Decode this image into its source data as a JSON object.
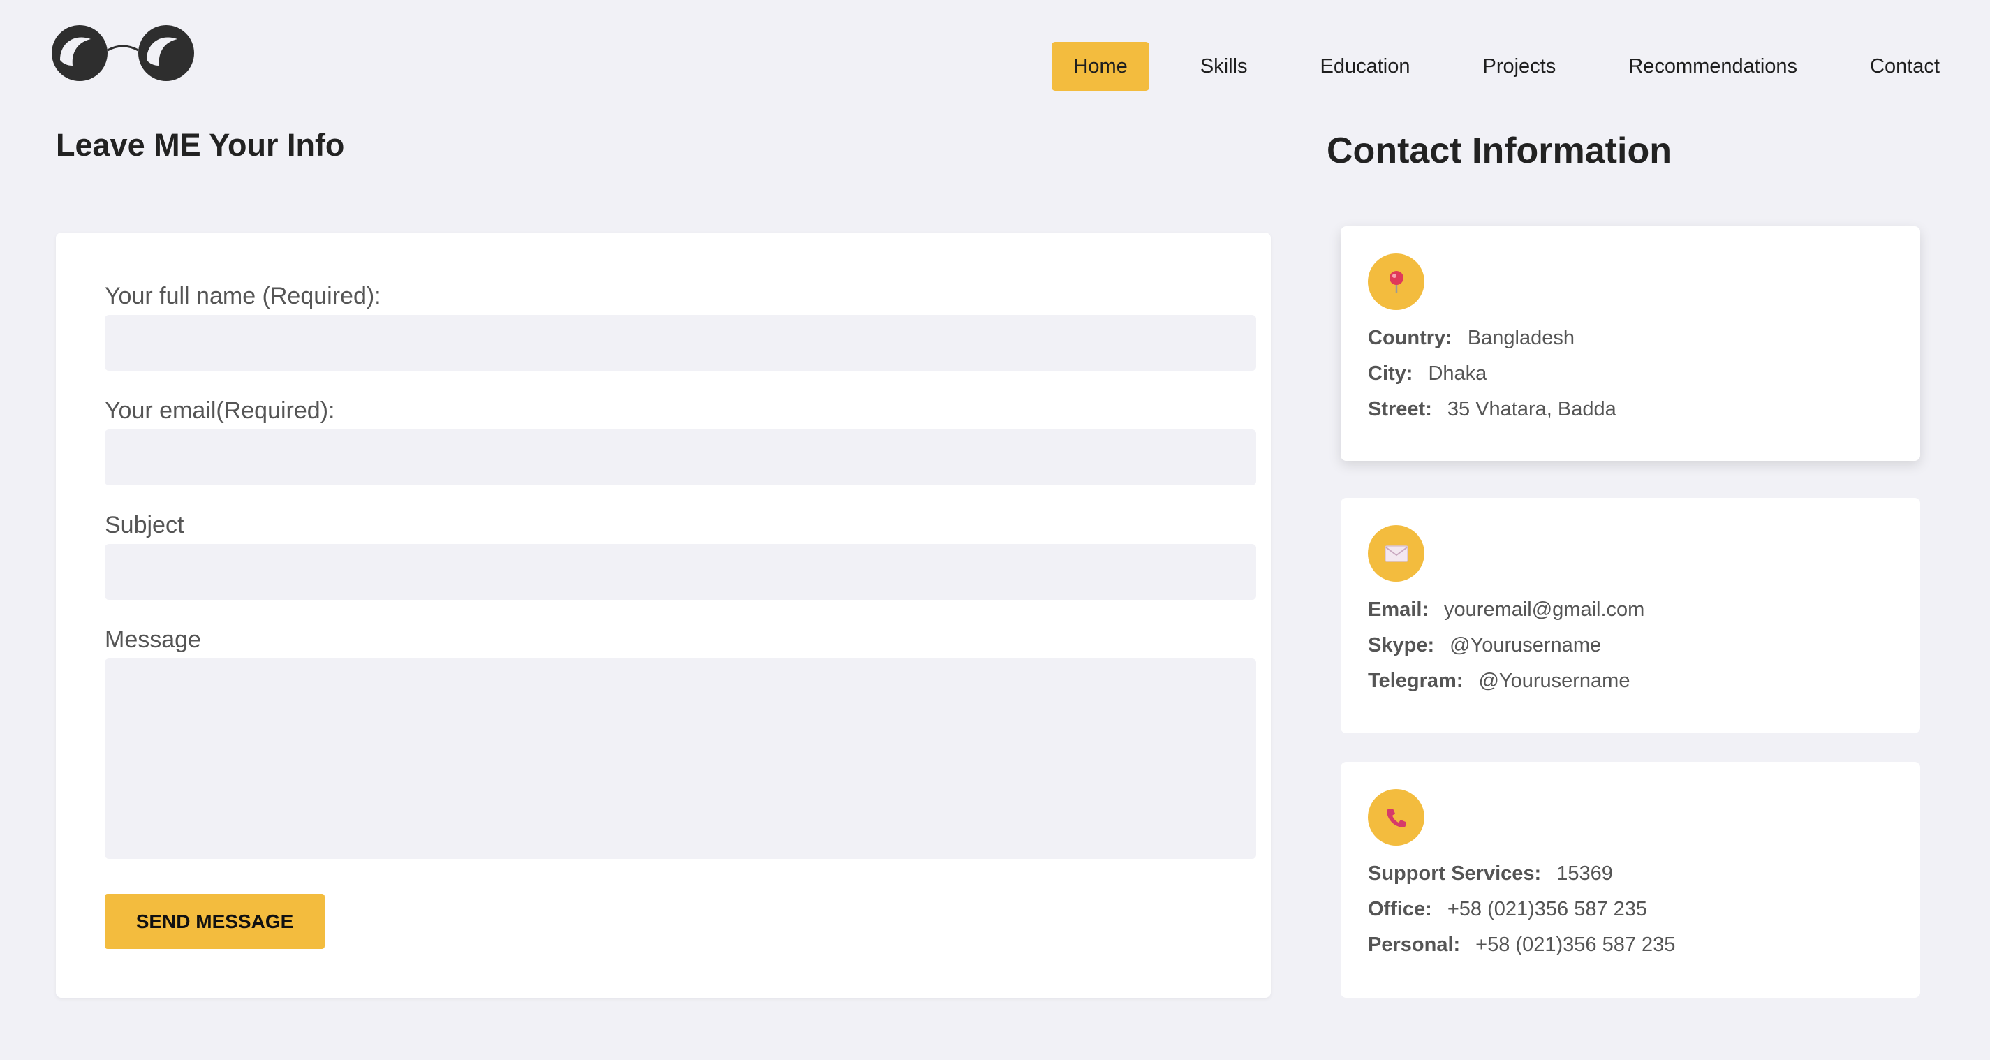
{
  "nav": {
    "items": [
      {
        "label": "Home",
        "active": true
      },
      {
        "label": "Skills",
        "active": false
      },
      {
        "label": "Education",
        "active": false
      },
      {
        "label": "Projects",
        "active": false
      },
      {
        "label": "Recommendations",
        "active": false
      },
      {
        "label": "Contact",
        "active": false
      }
    ]
  },
  "form": {
    "heading": "Leave ME Your Info",
    "name_label": "Your full name (Required):",
    "name_value": "",
    "email_label": "Your email(Required):",
    "email_value": "",
    "subject_label": "Subject",
    "subject_value": "",
    "message_label": "Message",
    "message_value": "",
    "send_label": "SEND MESSAGE"
  },
  "contact": {
    "heading": "Contact Information",
    "location": {
      "icon": "pin-icon",
      "rows": [
        {
          "key": "Country:",
          "value": "Bangladesh"
        },
        {
          "key": "City:",
          "value": "Dhaka"
        },
        {
          "key": "Street:",
          "value": "35 Vhatara, Badda"
        }
      ]
    },
    "online": {
      "icon": "envelope-icon",
      "rows": [
        {
          "key": "Email:",
          "value": "youremail@gmail.com"
        },
        {
          "key": "Skype:",
          "value": "@Yourusername"
        },
        {
          "key": "Telegram:",
          "value": "@Yourusername"
        }
      ]
    },
    "phone": {
      "icon": "phone-icon",
      "rows": [
        {
          "key": "Support Services:",
          "value": "15369"
        },
        {
          "key": "Office:",
          "value": "+58 (021)356 587 235"
        },
        {
          "key": "Personal:",
          "value": "+58 (021)356 587 235"
        }
      ]
    }
  },
  "colors": {
    "accent": "#f3bc3e",
    "background": "#f1f1f6",
    "card": "#ffffff"
  }
}
